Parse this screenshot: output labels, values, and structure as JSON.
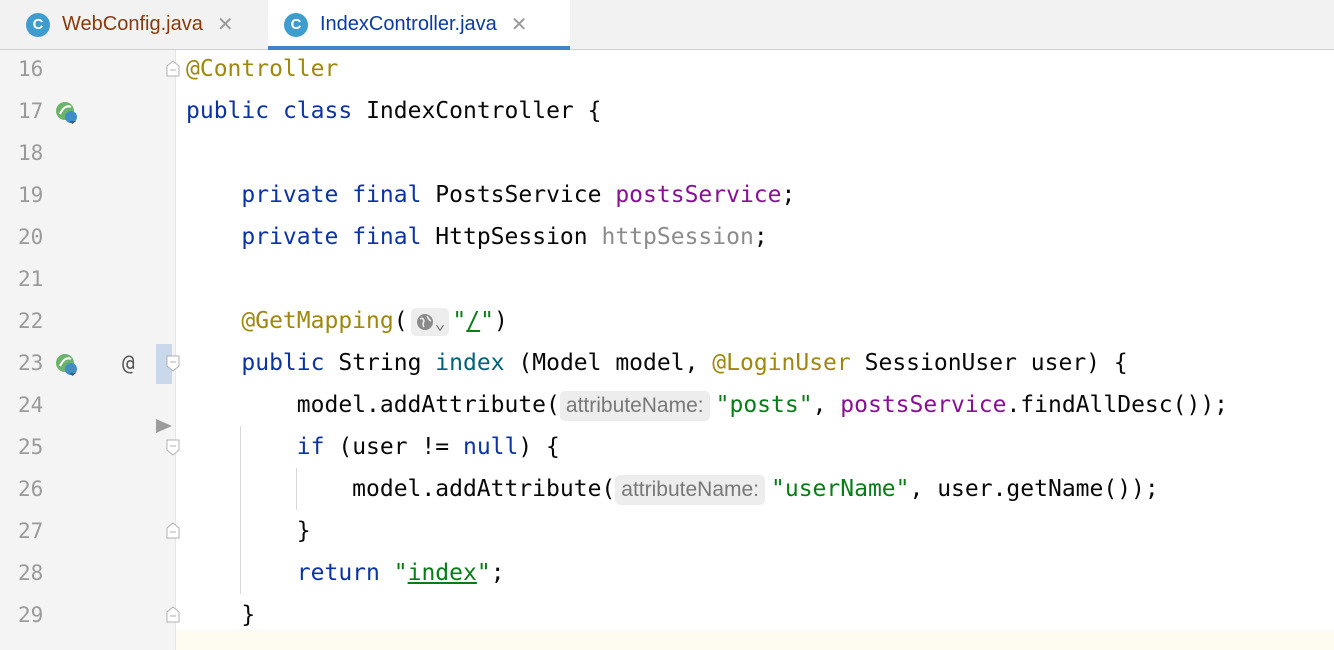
{
  "tabs": [
    {
      "letter": "C",
      "label": "WebConfig.java",
      "close": "✕"
    },
    {
      "letter": "C",
      "label": "IndexController.java",
      "close": "✕"
    }
  ],
  "gutter": {
    "at_symbol": "@"
  },
  "lines": [
    {
      "num": "16"
    },
    {
      "num": "17"
    },
    {
      "num": "18"
    },
    {
      "num": "19"
    },
    {
      "num": "20"
    },
    {
      "num": "21"
    },
    {
      "num": "22"
    },
    {
      "num": "23"
    },
    {
      "num": "24"
    },
    {
      "num": "25"
    },
    {
      "num": "26"
    },
    {
      "num": "27"
    },
    {
      "num": "28"
    },
    {
      "num": "29"
    }
  ],
  "code": {
    "l16": {
      "ann": "@Controller"
    },
    "l17": {
      "kw1": "public",
      "kw2": "class",
      "rest": "IndexController {"
    },
    "l19": {
      "kw1": "private",
      "kw2": "final",
      "type": "PostsService",
      "field": "postsService",
      "end": ";"
    },
    "l20": {
      "kw1": "private",
      "kw2": "final",
      "type": "HttpSession",
      "field": "httpSession",
      "end": ";"
    },
    "l22": {
      "ann": "@GetMapping",
      "open": "(",
      "glyph": "⌄",
      "q1": "\"",
      "path": "/",
      "q2": "\"",
      "close": ")"
    },
    "l23": {
      "kw1": "public",
      "type": "String",
      "method": "index",
      "p1": "(Model model,",
      "ann": "@LoginUser",
      "p2": "SessionUser user) {"
    },
    "l24": {
      "call": "model.addAttribute(",
      "hint": "attributeName:",
      "str": "\"posts\"",
      "sep": ",",
      "field": "postsService",
      "tail": ".findAllDesc());"
    },
    "l25": {
      "kw": "if",
      "rest": "(user != ",
      "kw2": "null",
      "end": ") {"
    },
    "l26": {
      "call": "model.addAttribute(",
      "hint": "attributeName:",
      "str": "\"userName\"",
      "tail": ", user.getName());"
    },
    "l27": {
      "brace": "}"
    },
    "l28": {
      "kw": "return",
      "q1": "\"",
      "str": "index",
      "q2": "\"",
      "end": ";"
    },
    "l29": {
      "brace": "}"
    }
  },
  "colors": {
    "keyword": "#0b33a3",
    "annotation": "#9e880d",
    "field": "#871094",
    "string": "#067d17",
    "tab_accent": "#4083c9"
  }
}
